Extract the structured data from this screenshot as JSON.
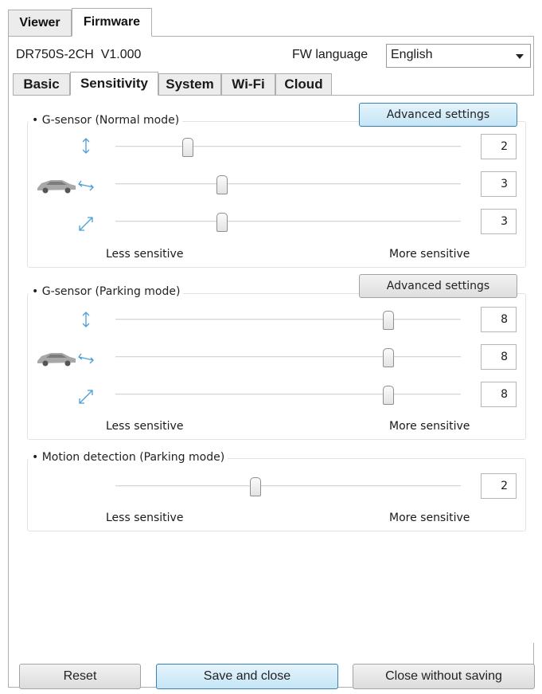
{
  "top_tabs": [
    {
      "label": "Viewer",
      "active": false
    },
    {
      "label": "Firmware",
      "active": true
    }
  ],
  "header": {
    "model": "DR750S-2CH",
    "version": "V1.000",
    "fw_language_label": "FW language",
    "fw_language_value": "English"
  },
  "sub_tabs": [
    {
      "label": "Basic",
      "active": false
    },
    {
      "label": "Sensitivity",
      "active": true
    },
    {
      "label": "System",
      "active": false
    },
    {
      "label": "Wi-Fi",
      "active": false
    },
    {
      "label": "Cloud",
      "active": false
    }
  ],
  "groups": {
    "normal": {
      "title": "G-sensor (Normal mode)",
      "advanced_label": "Advanced settings",
      "sliders": [
        {
          "axis": "vertical-axis-icon",
          "value": "2",
          "level": 0.2
        },
        {
          "axis": "horizontal-axis-icon",
          "value": "3",
          "level": 0.3
        },
        {
          "axis": "diagonal-axis-icon",
          "value": "3",
          "level": 0.3
        }
      ],
      "less": "Less sensitive",
      "more": "More sensitive"
    },
    "parking": {
      "title": "G-sensor (Parking mode)",
      "advanced_label": "Advanced settings",
      "sliders": [
        {
          "axis": "vertical-axis-icon",
          "value": "8",
          "level": 0.8
        },
        {
          "axis": "horizontal-axis-icon",
          "value": "8",
          "level": 0.8
        },
        {
          "axis": "diagonal-axis-icon",
          "value": "8",
          "level": 0.8
        }
      ],
      "less": "Less sensitive",
      "more": "More sensitive"
    },
    "motion": {
      "title": "Motion detection (Parking mode)",
      "slider": {
        "value": "2",
        "level": 0.4
      },
      "less": "Less sensitive",
      "more": "More sensitive"
    }
  },
  "buttons": {
    "reset": "Reset",
    "save_close": "Save and close",
    "close_no_save": "Close without saving"
  },
  "colors": {
    "accent": "#3c7fb1",
    "axis_icon": "#4a9fd8"
  }
}
